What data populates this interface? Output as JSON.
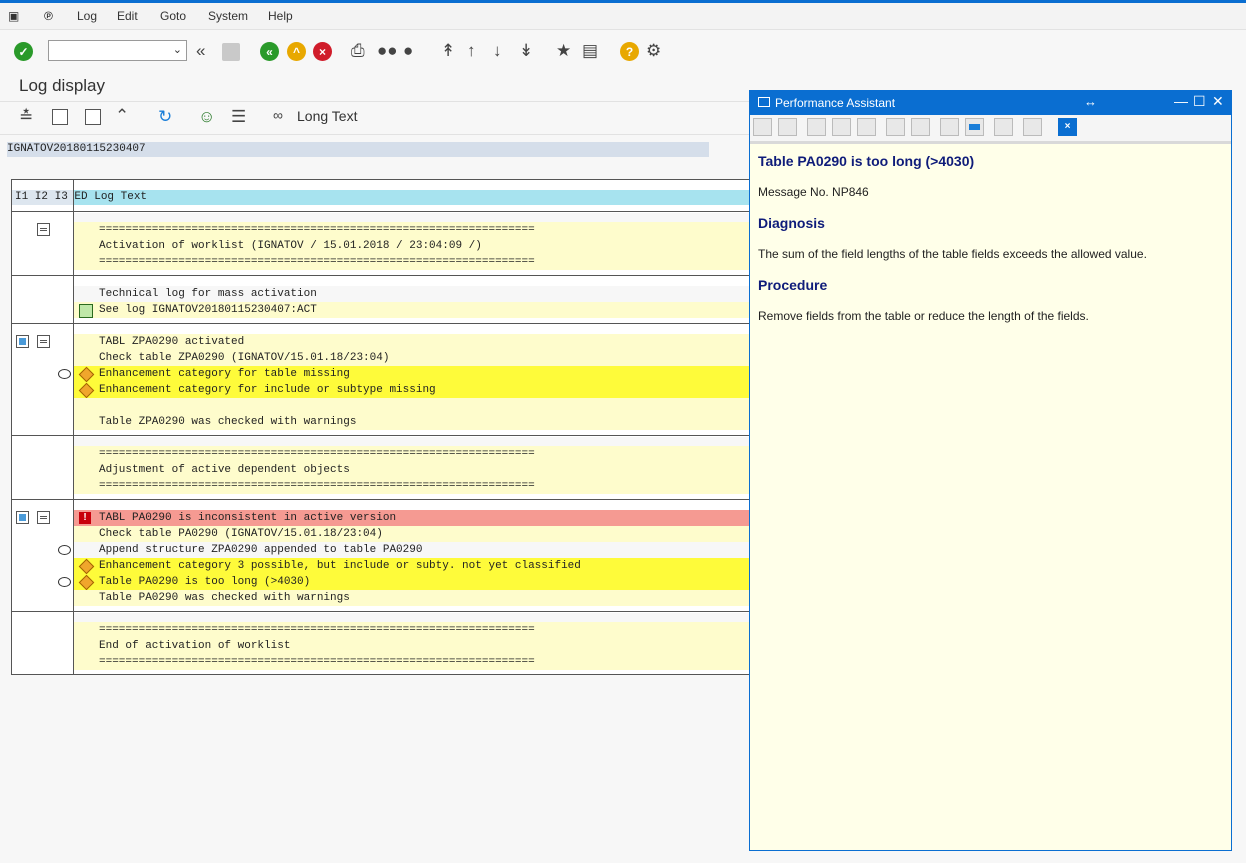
{
  "menu": {
    "items": [
      "Log",
      "Edit",
      "Goto",
      "System",
      "Help"
    ]
  },
  "toolbar": {
    "command_field_value": ""
  },
  "page": {
    "title": "Log display",
    "long_text_label": "Long Text",
    "log_name": "IGNATOV20180115230407"
  },
  "log": {
    "header": "I1 I2 I3 ED Log Text",
    "rows": [
      "==================================================================",
      "Activation of worklist (IGNATOV / 15.01.2018 / 23:04:09 /)",
      "==================================================================",
      "Technical log for mass activation",
      "See log IGNATOV20180115230407:ACT",
      "TABL ZPA0290 activated",
      "Check table ZPA0290 (IGNATOV/15.01.18/23:04)",
      "Enhancement category for table missing",
      "Enhancement category for include or subtype missing",
      "Table ZPA0290 was checked with warnings",
      "==================================================================",
      "Adjustment of active dependent objects",
      "==================================================================",
      "TABL PA0290 is inconsistent in active version",
      "Check table PA0290 (IGNATOV/15.01.18/23:04)",
      "Append structure ZPA0290 appended to table PA0290",
      "Enhancement category 3 possible, but include or subty. not yet classified",
      "Table PA0290 is too long (>4030)",
      "Table PA0290 was checked with warnings",
      "==================================================================",
      "End of activation of worklist",
      "=================================================================="
    ]
  },
  "assistant": {
    "title": "Performance Assistant",
    "heading": "Table PA0290 is too long (>4030)",
    "message_no": "Message No. NP846",
    "diagnosis_heading": "Diagnosis",
    "diagnosis_text": "The sum of the field lengths of the table fields exceeds the allowed value.",
    "procedure_heading": "Procedure",
    "procedure_text": "Remove fields from the table or reduce the length of the fields."
  },
  "colors": {
    "accent": "#0a6ed1",
    "warning_row": "#fefb3a",
    "error_row": "#f59a92",
    "info_row": "#fefccc"
  }
}
